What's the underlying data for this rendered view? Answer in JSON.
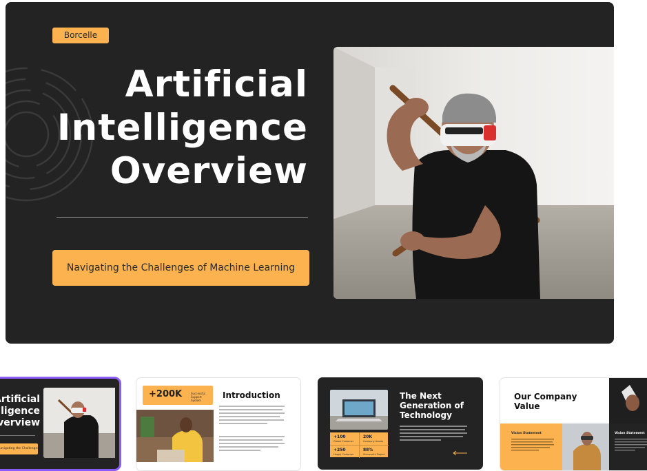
{
  "slide": {
    "brand": "Borcelle",
    "title_lines": [
      "Artificial",
      "Intelligence",
      "Overview"
    ],
    "subtitle": "Navigating the Challenges of Machine Learning"
  },
  "thumbnails": [
    {
      "title_lines": [
        "Artificial",
        "Intelligence",
        "Overview"
      ],
      "subtitle": "Navigating the Challenges of Machine Learning"
    },
    {
      "stat_value": "+200K",
      "stat_caption": "Successful Support System",
      "heading": "Introduction"
    },
    {
      "heading_lines": [
        "The Next",
        "Generation of",
        "Technology"
      ],
      "stats": [
        {
          "value": "+100",
          "caption": "Global Customer"
        },
        {
          "value": "20K",
          "caption": "Company Assets"
        },
        {
          "value": "+250",
          "caption": "Happy Customer"
        },
        {
          "value": "88%",
          "caption": "Successful Project"
        }
      ]
    },
    {
      "heading_lines": [
        "Our Company",
        "Value"
      ],
      "label_1": "Vision Statement",
      "label_2": "Vision Statement"
    }
  ],
  "colors": {
    "slide_bg": "#232323",
    "accent": "#fcb24f",
    "selection": "#8b5cf6"
  }
}
